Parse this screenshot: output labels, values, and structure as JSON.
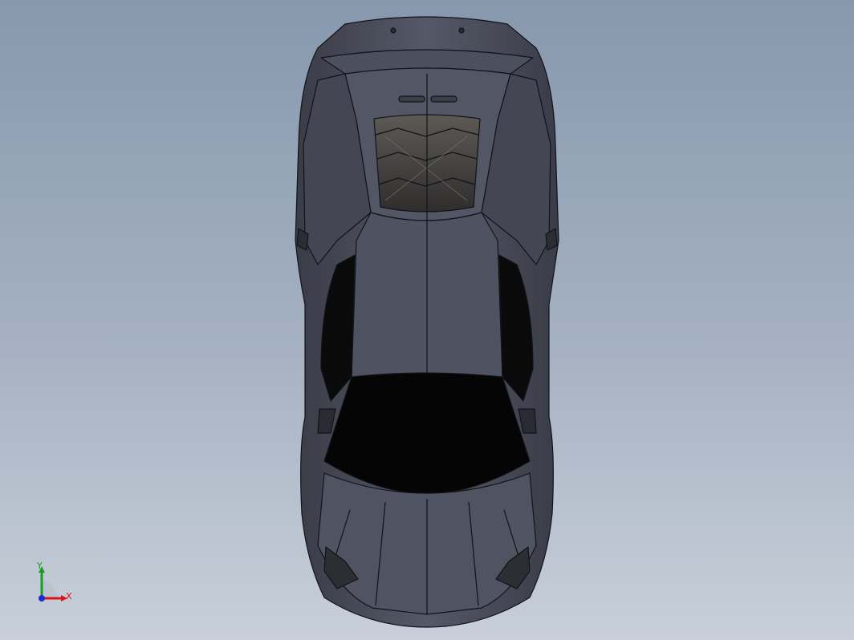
{
  "viewport": {
    "background_top": "#8798ad",
    "background_bottom": "#c8cfd9",
    "model_body_color": "#4a4d5c",
    "model_edge_color": "#111318",
    "glass_color": "#050505"
  },
  "triad": {
    "x_label": "X",
    "y_label": "Y",
    "x_color": "#d9141b",
    "y_color": "#1a9a26",
    "z_color": "#1c2bd0"
  }
}
